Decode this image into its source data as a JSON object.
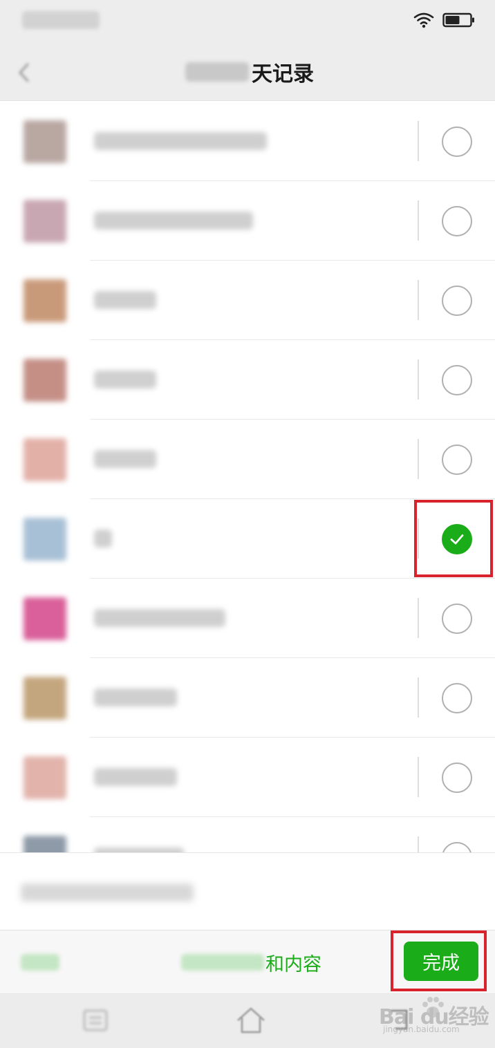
{
  "status_bar": {
    "wifi_icon": "wifi-icon",
    "battery_icon": "battery-icon"
  },
  "nav": {
    "back_icon": "back-arrow-icon",
    "title_visible": "天记录"
  },
  "colors": {
    "accent_green": "#1aad19",
    "highlight_red": "#d9232c",
    "nav_background": "#ededed"
  },
  "chats": [
    {
      "avatar_color": "#b9a7a2",
      "selected": false
    },
    {
      "avatar_color": "#c8a6b2",
      "selected": false
    },
    {
      "avatar_color": "#c99a7a",
      "selected": false
    },
    {
      "avatar_color": "#c58f86",
      "selected": false
    },
    {
      "avatar_color": "#e3b0a8",
      "selected": false
    },
    {
      "avatar_color": "#a8c0d6",
      "selected": true
    },
    {
      "avatar_color": "#d9609a",
      "selected": false
    },
    {
      "avatar_color": "#c4a67e",
      "selected": false
    },
    {
      "avatar_color": "#e2b3ab",
      "selected": false
    },
    {
      "avatar_color": "#8e9aa8",
      "selected": false
    }
  ],
  "action_bar": {
    "filter_visible": "和内容",
    "done_label": "完成"
  },
  "system_nav": {
    "menu_icon": "menu-icon",
    "home_icon": "home-icon",
    "back_icon": "back-icon"
  },
  "watermark": {
    "brand": "Bai du经验",
    "url": "jingyan.baidu.com"
  }
}
